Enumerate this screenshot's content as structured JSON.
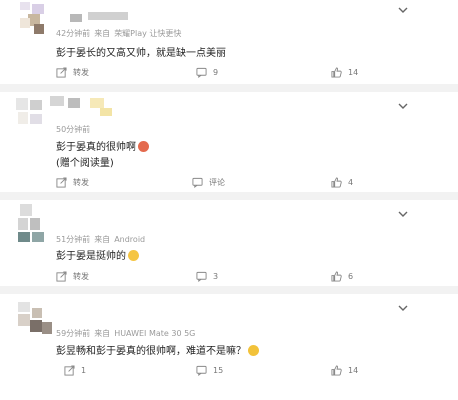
{
  "comments": [
    {
      "meta": {
        "time": "42分钟前",
        "source_prefix": "来自",
        "device": "荣耀Play 让快更快"
      },
      "text": "彭于晏长的又高又帅，就是缺一点美丽",
      "text2": "",
      "actions": {
        "share": "转发",
        "comment": "9",
        "like": "14"
      }
    },
    {
      "meta": {
        "time": "50分钟前",
        "source_prefix": "",
        "device": ""
      },
      "text": "彭于晏真的很帅啊",
      "text2": "(赠个阅读量)",
      "actions": {
        "share": "转发",
        "comment": "评论",
        "like": "4"
      }
    },
    {
      "meta": {
        "time": "51分钟前",
        "source_prefix": "来自",
        "device": "Android"
      },
      "text": "彭于晏是挺帅的",
      "text2": "",
      "actions": {
        "share": "转发",
        "comment": "3",
        "like": "6"
      }
    },
    {
      "meta": {
        "time": "59分钟前",
        "source_prefix": "来自",
        "device": "HUAWEI Mate 30 5G"
      },
      "text": "彭昱畅和彭于晏真的很帅啊，难道不是嘛？",
      "text2": "",
      "actions": {
        "share": "1",
        "comment": "15",
        "like": "14"
      }
    }
  ],
  "icons": {
    "share": "share-icon",
    "comment": "comment-icon",
    "like": "like-icon",
    "menu": "chevron-down-icon"
  },
  "colors": {
    "meta": "#9a9a9a",
    "text": "#222222",
    "actions": "#777777",
    "separator": "#f2f2f2"
  }
}
